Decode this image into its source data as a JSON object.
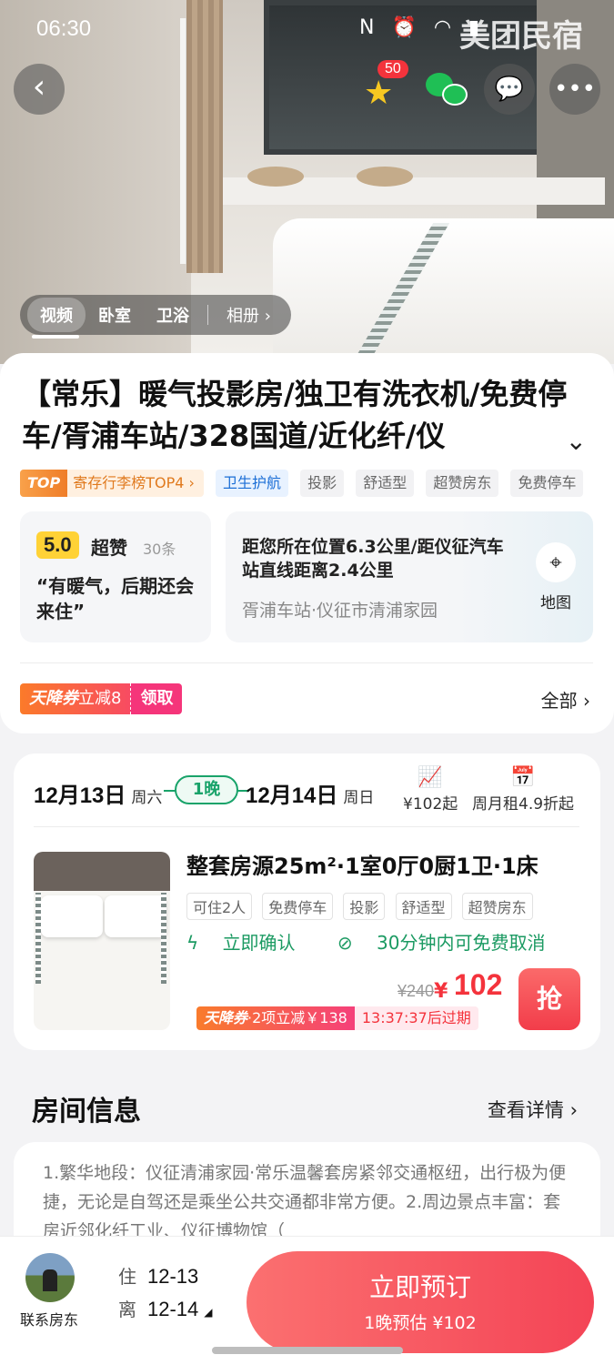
{
  "status_bar": {
    "time": "06:30",
    "icons": "N ⏰ ◠ ▮",
    "watermark": "美团民宿"
  },
  "hero": {
    "fav_count": "50",
    "media_tabs": [
      "视频",
      "卧室",
      "卫浴"
    ],
    "album_label": "相册 ›"
  },
  "listing": {
    "title": "【常乐】暖气投影房/独卫有洗衣机/免费停车/胥浦车站/328国道/近化纤/仪",
    "tags": {
      "rank_top": "TOP",
      "rank_text": "寄存行李榜TOP4 ›",
      "hygiene": "卫生护航",
      "others": [
        "投影",
        "舒适型",
        "超赞房东",
        "免费停车"
      ]
    },
    "rating": {
      "score": "5.0",
      "word": "超赞",
      "count": "30条",
      "quote": "“有暖气，后期还会来住”"
    },
    "location": {
      "distance": "距您所在位置6.3公里/距仪征汽车站直线距离2.4公里",
      "area": "胥浦车站·仪征市清浦家园",
      "map_label": "地图"
    },
    "coupon": {
      "brand": "天降券",
      "text": "立减8",
      "get": "领取"
    },
    "all_label": "全部 ›"
  },
  "booking": {
    "checkin": {
      "date": "12月13日",
      "weekday": "周六"
    },
    "nights": "1晚",
    "checkout": {
      "date": "12月14日",
      "weekday": "周日"
    },
    "price_trend": "¥102起",
    "monthly": "周月租4.9折起",
    "room": {
      "title": "整套房源25m²·1室0厅0厨1卫·1床",
      "tags": [
        "可住2人",
        "免费停车",
        "投影",
        "舒适型",
        "超赞房东"
      ],
      "feature_confirm": "立即确认",
      "feature_cancel": "30分钟内可免费取消",
      "price_old": "¥240",
      "price_symbol": "¥",
      "price_new": "102",
      "grab": "抢",
      "promo_brand": "天降券",
      "promo_text": "·2项立减￥138",
      "promo_time": "13:37:37后过期"
    }
  },
  "room_info": {
    "title": "房间信息",
    "link": "查看详情 ›",
    "text": "1.繁华地段：仪征清浦家园·常乐温馨套房紧邻交通枢纽，出行极为便捷，无论是自驾还是乘坐公共交通都非常方便。2.周边景点丰富：套房近邻化纤工业、仪征博物馆（"
  },
  "bottom_bar": {
    "contact": "联系房东",
    "checkin_label": "住",
    "checkin": "12-13",
    "checkout_label": "离",
    "checkout": "12-14",
    "book": "立即预订",
    "book_sub": "1晚预估 ¥102"
  },
  "colors": {
    "accent_red": "#f4333c",
    "green": "#19a36a",
    "coupon_orange": "#fb7a2a"
  }
}
